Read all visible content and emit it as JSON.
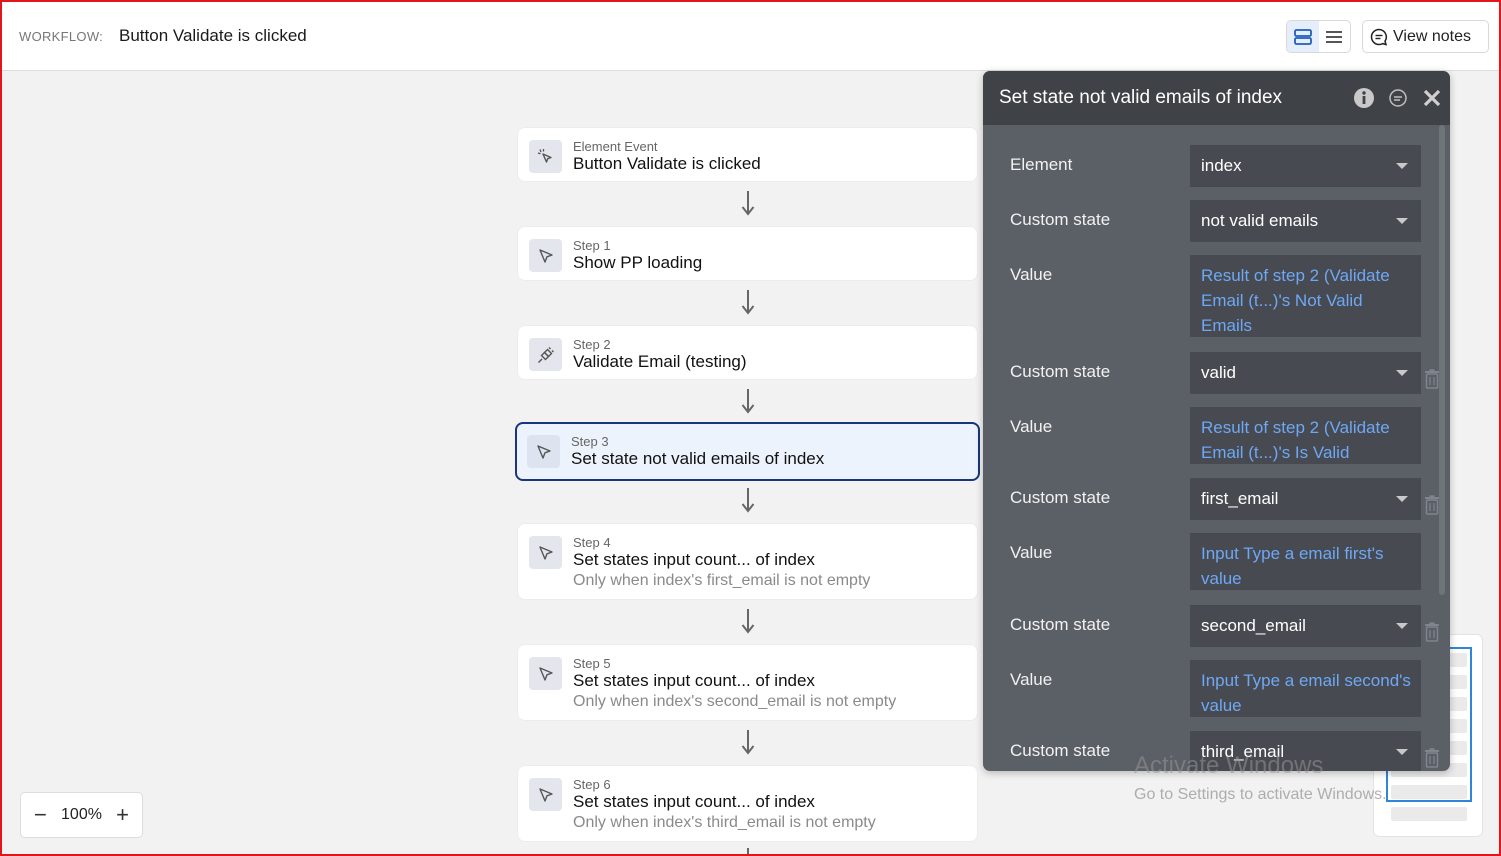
{
  "header": {
    "label": "WORKFLOW:",
    "title": "Button Validate is clicked",
    "view_notes": "View notes"
  },
  "steps": [
    {
      "sub": "Element Event",
      "title": "Button Validate is clicked",
      "cond": "",
      "icon": "pointer-click-icon"
    },
    {
      "sub": "Step 1",
      "title": "Show PP loading",
      "cond": "",
      "icon": "cursor-icon"
    },
    {
      "sub": "Step 2",
      "title": "Validate Email (testing)",
      "cond": "",
      "icon": "plugin-icon"
    },
    {
      "sub": "Step 3",
      "title": "Set state not valid emails of index",
      "cond": "",
      "icon": "cursor-icon",
      "selected": true
    },
    {
      "sub": "Step 4",
      "title": "Set states input count... of index",
      "cond": "Only when index's first_email is not empty",
      "icon": "cursor-icon"
    },
    {
      "sub": "Step 5",
      "title": "Set states input count... of index",
      "cond": "Only when index's second_email is not empty",
      "icon": "cursor-icon"
    },
    {
      "sub": "Step 6",
      "title": "Set states input count... of index",
      "cond": "Only when index's third_email is not empty",
      "icon": "cursor-icon"
    }
  ],
  "zoom": {
    "minus": "−",
    "level": "100%",
    "plus": "+"
  },
  "panel": {
    "title": "Set state not valid emails of index",
    "rows": [
      {
        "label": "Element",
        "type": "dropdown",
        "value": "index"
      },
      {
        "label": "Custom state",
        "type": "dropdown",
        "value": "not valid emails"
      },
      {
        "label": "Value",
        "type": "expression",
        "value": "Result of step 2 (Validate Email (t...)'s Not Valid Emails"
      },
      {
        "label": "Custom state",
        "type": "dropdown",
        "value": "valid"
      },
      {
        "label": "Value",
        "type": "expression",
        "value": "Result of step 2 (Validate Email (t...)'s Is Valid"
      },
      {
        "label": "Custom state",
        "type": "dropdown",
        "value": "first_email"
      },
      {
        "label": "Value",
        "type": "expression",
        "value": "Input Type a email first's value"
      },
      {
        "label": "Custom state",
        "type": "dropdown",
        "value": "second_email"
      },
      {
        "label": "Value",
        "type": "expression",
        "value": "Input Type a email second's value"
      },
      {
        "label": "Custom state",
        "type": "dropdown",
        "value": "third_email"
      }
    ]
  },
  "watermark": {
    "line1": "Activate Windows",
    "line2": "Go to Settings to activate Windows."
  },
  "colors": {
    "accent": "#1a3578",
    "expression": "#6ea8f5",
    "panel_bg": "#5b5f66",
    "frame": "#e0161b"
  }
}
